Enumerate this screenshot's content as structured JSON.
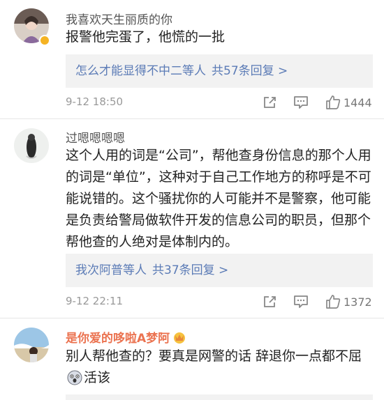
{
  "comments": [
    {
      "username": "我喜欢天生丽质的你",
      "text": "报警他完蛋了，他慌的一批",
      "replies_names": "怎么才能显得不中二等人",
      "replies_count": "共57条回复 >",
      "timestamp": "9-12 18:50",
      "likes": "1444",
      "share_icon": "share-icon",
      "comment_icon": "comment-icon",
      "like_icon": "thumbs-up-icon"
    },
    {
      "username": "过嗯嗯嗯嗯",
      "text": "这个人用的词是“公司”，帮他查身份信息的那个人用的词是“单位”，这种对于自己工作地方的称呼是不可能说错的。这个骚扰你的人可能并不是警察，他可能是负责给警局做软件开发的信息公司的职员，但那个帮他查的人绝对是体制内的。",
      "replies_names": "我次阿普等人",
      "replies_count": "共37条回复 >",
      "timestamp": "9-12 22:11",
      "likes": "1372",
      "share_icon": "share-icon",
      "comment_icon": "comment-icon",
      "like_icon": "thumbs-up-icon"
    },
    {
      "username": "是你爱的哆啦A梦阿",
      "text_part1": "别人帮他查的？要真是网警的话 辞退你一点都不屈",
      "text_part2": "活该",
      "badge_icon": "crown-badge-icon",
      "emoji_icon": "shocked-face-emoji"
    }
  ],
  "colors": {
    "link": "#5b7bb6",
    "vip_name": "#eb7350",
    "reply_bg": "#f2f2f2",
    "meta": "#999999"
  }
}
